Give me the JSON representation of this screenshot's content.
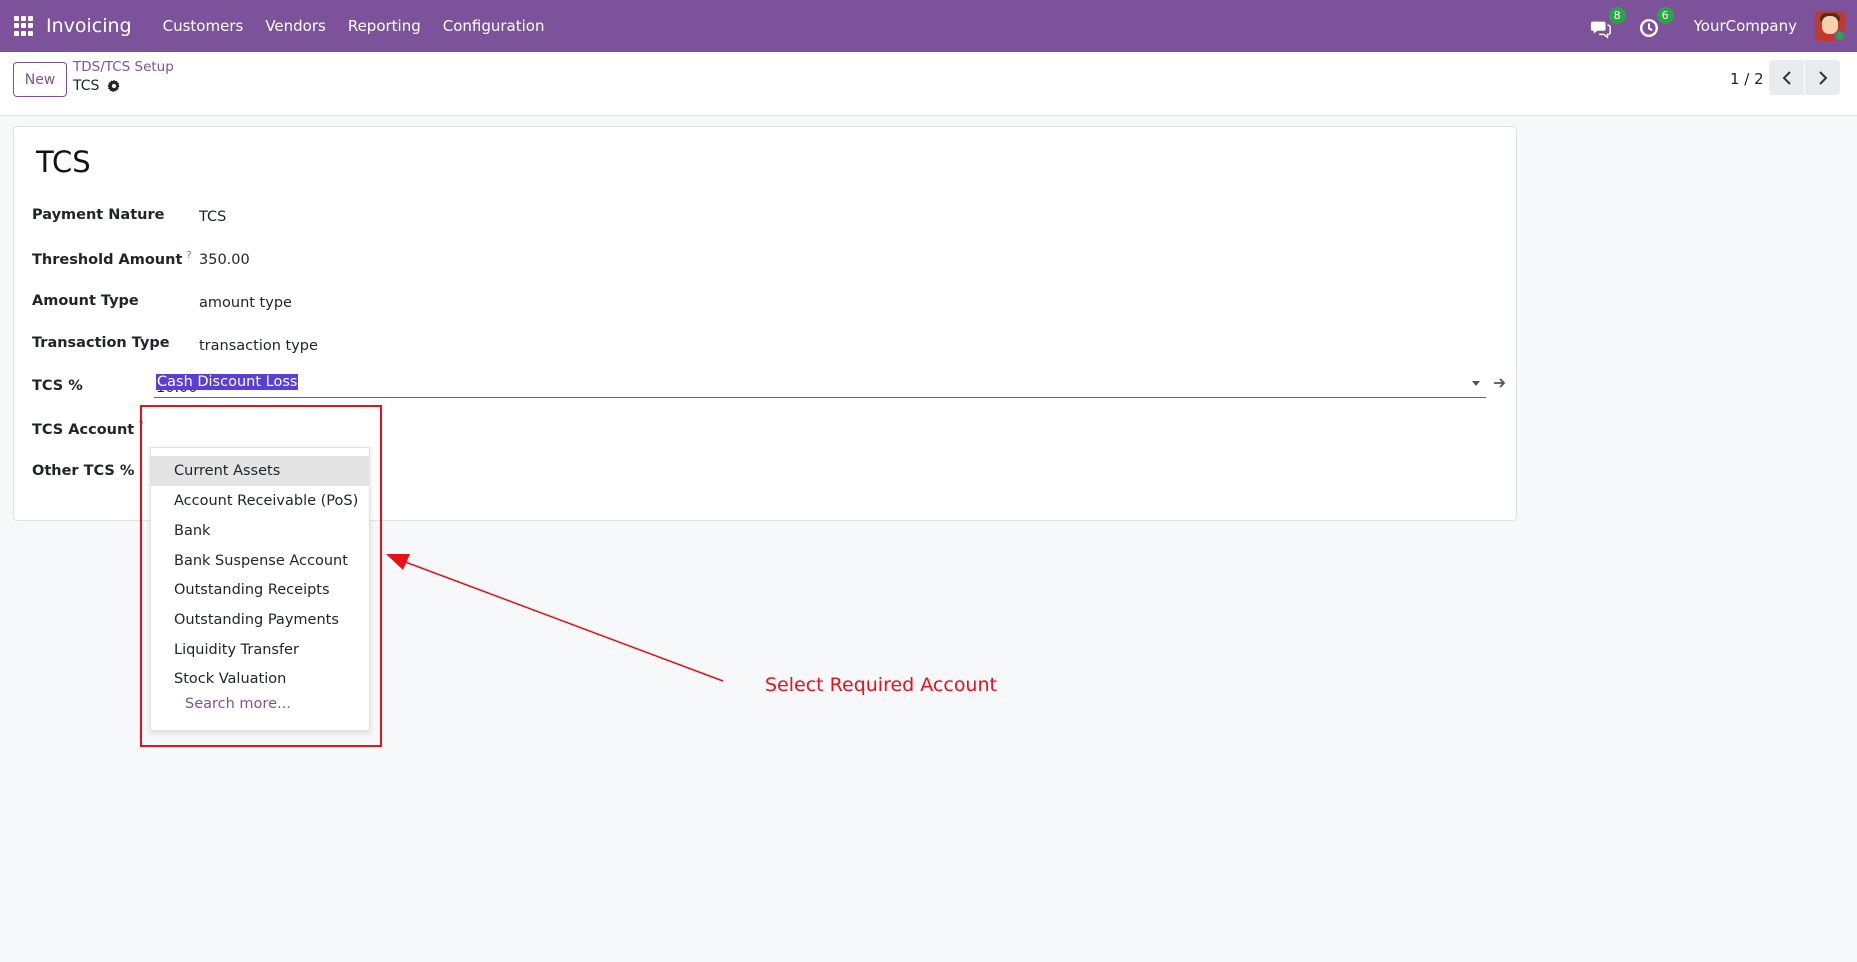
{
  "navbar": {
    "brand": "Invoicing",
    "menu": [
      "Customers",
      "Vendors",
      "Reporting",
      "Configuration"
    ],
    "messages_badge": "8",
    "activities_badge": "6",
    "company": "YourCompany"
  },
  "control_panel": {
    "new_label": "New",
    "breadcrumb_parent": "TDS/TCS Setup",
    "breadcrumb_current": "TCS",
    "pager": "1 / 2"
  },
  "form": {
    "title": "TCS",
    "fields": {
      "payment_nature": {
        "label": "Payment Nature",
        "value": "TCS"
      },
      "threshold_amount": {
        "label": "Threshold Amount",
        "help": "?",
        "value": "350.00"
      },
      "amount_type": {
        "label": "Amount Type",
        "value": "amount type"
      },
      "transaction_type": {
        "label": "Transaction Type",
        "value": "transaction type"
      },
      "tcs_percent": {
        "label": "TCS %",
        "value": "10.00"
      },
      "tcs_account": {
        "label": "TCS Account",
        "help": "?",
        "value": "Cash Discount Loss"
      },
      "other_tcs_percent": {
        "label": "Other TCS %"
      }
    }
  },
  "dropdown": {
    "items": [
      "Current Assets",
      "Account Receivable (PoS)",
      "Bank",
      "Bank Suspense Account",
      "Outstanding Receipts",
      "Outstanding Payments",
      "Liquidity Transfer",
      "Stock Valuation"
    ],
    "search_more": "Search more..."
  },
  "annotation": {
    "text": "Select Required Account",
    "color": "#e8101a"
  },
  "colors": {
    "navbar": "#7c539a",
    "accent": "#7c539a",
    "selection": "#5a3fd6",
    "badge": "#28a745"
  }
}
